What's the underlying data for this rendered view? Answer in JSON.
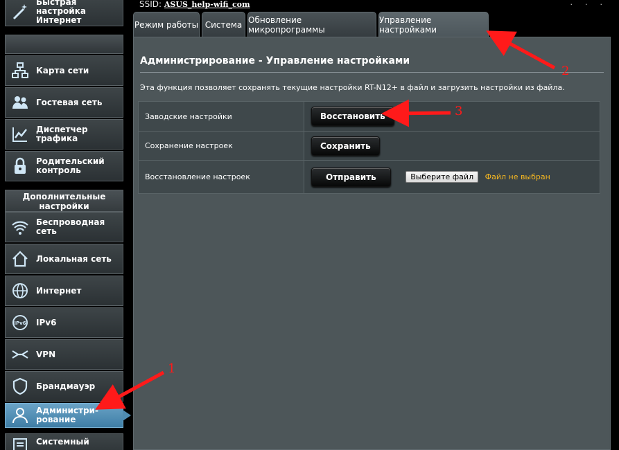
{
  "topbar": {
    "ssid_label": "SSID:",
    "ssid_value": "ASUS_help-wifi_com"
  },
  "sidebar": {
    "quick_setup": "Быстрая настройка Интернет",
    "items": [
      {
        "label": "Карта сети",
        "icon": "network-map-icon"
      },
      {
        "label": "Гостевая сеть",
        "icon": "guest-network-icon"
      },
      {
        "label": "Диспетчер трафика",
        "icon": "traffic-manager-icon"
      },
      {
        "label": "Родительский контроль",
        "icon": "parental-control-icon"
      }
    ],
    "advanced_header": "Дополнительные настройки",
    "advanced_items": [
      {
        "label": "Беспроводная сеть",
        "icon": "wireless-icon"
      },
      {
        "label": "Локальная сеть",
        "icon": "lan-icon"
      },
      {
        "label": "Интернет",
        "icon": "internet-globe-icon"
      },
      {
        "label": "IPv6",
        "icon": "ipv6-icon"
      },
      {
        "label": "VPN",
        "icon": "vpn-icon"
      },
      {
        "label": "Брандмауэр",
        "icon": "firewall-icon"
      },
      {
        "label": "Администри-рование",
        "icon": "administration-icon",
        "active": true
      },
      {
        "label": "Системный",
        "icon": "system-log-icon"
      }
    ]
  },
  "tabs": [
    {
      "label": "Режим работы"
    },
    {
      "label": "Система"
    },
    {
      "label": "Обновление микропрограммы"
    },
    {
      "label": "Управление настройками",
      "active": true
    }
  ],
  "main": {
    "title": "Администрирование - Управление настройками",
    "description": "Эта функция позволяет сохранять текущие настройки RT-N12+ в файл и загрузить настройки из файла.",
    "rows": [
      {
        "label": "Заводские настройки",
        "button": "Восстановить"
      },
      {
        "label": "Сохранение настроек",
        "button": "Сохранить"
      },
      {
        "label": "Восстановление настроек",
        "button": "Отправить",
        "file_button": "Выберите файл",
        "file_status": "Файл не выбран"
      }
    ]
  },
  "annotations": {
    "arrow_1": "1",
    "arrow_2": "2",
    "arrow_3": "3",
    "color": "#ff1a1a"
  }
}
